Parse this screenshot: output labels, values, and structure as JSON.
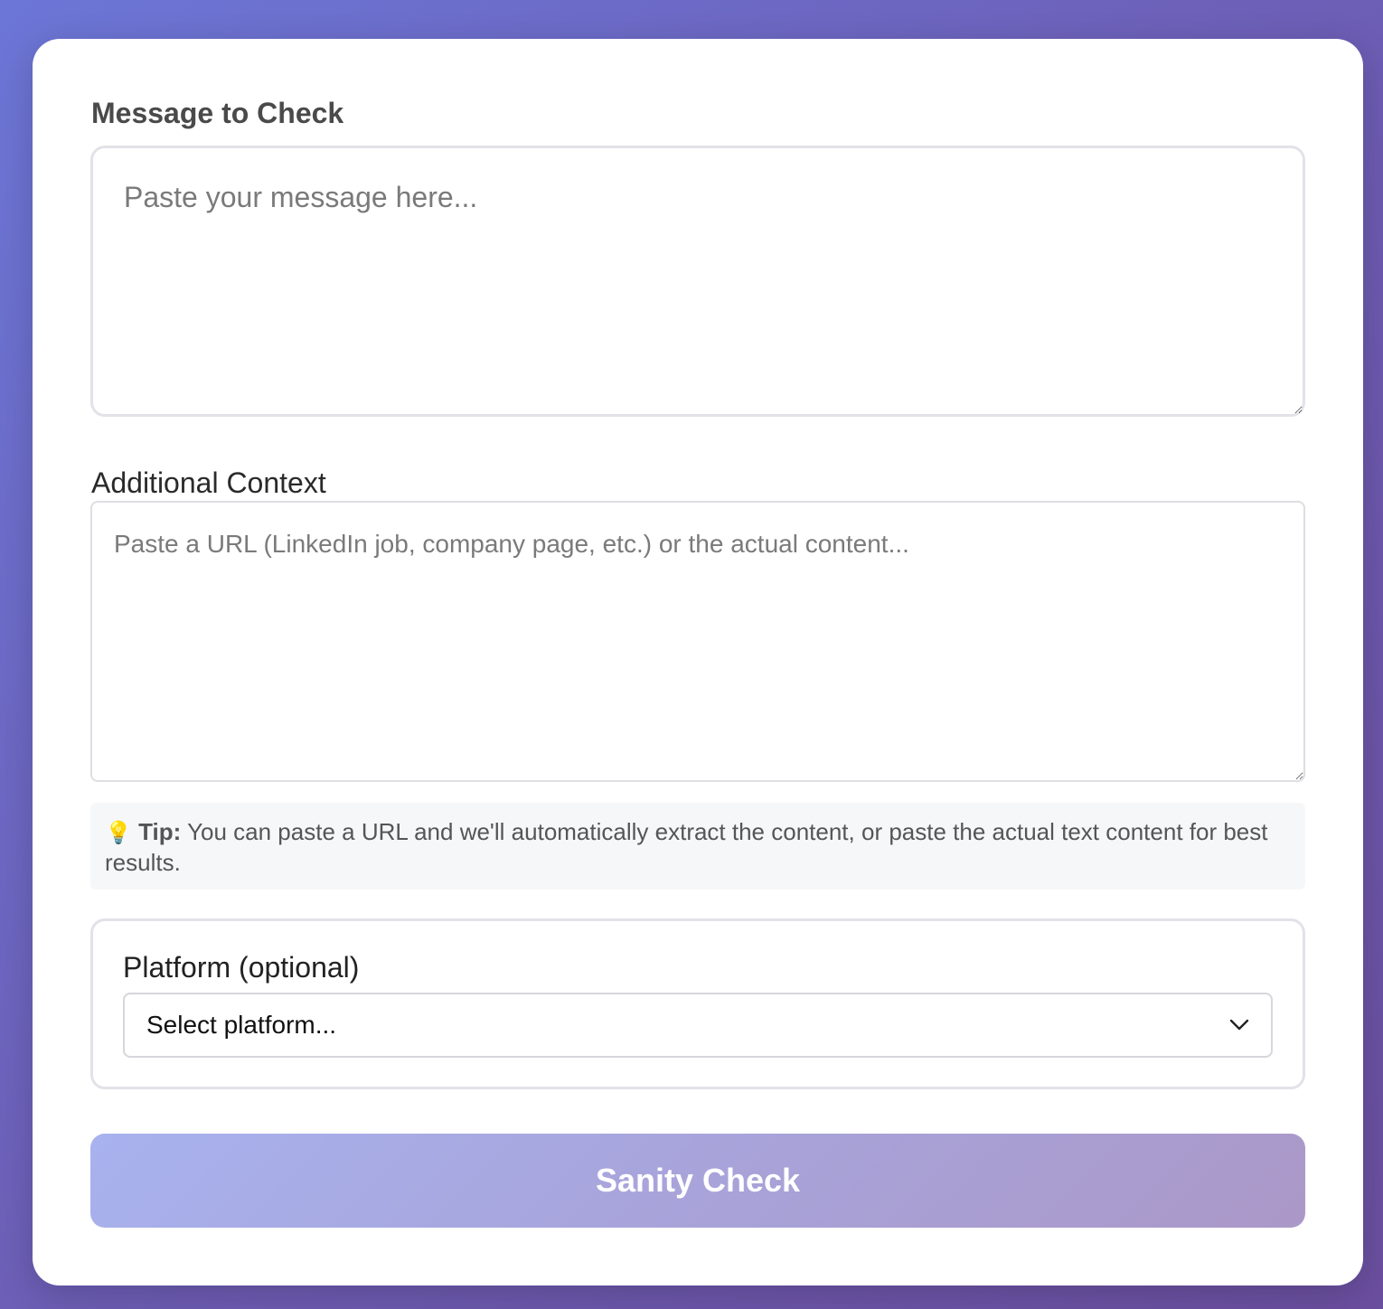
{
  "form": {
    "message": {
      "label": "Message to Check",
      "placeholder": "Paste your message here...",
      "value": ""
    },
    "context": {
      "label": "Additional Context",
      "placeholder": "Paste a URL (LinkedIn job, company page, etc.) or the actual content...",
      "value": ""
    },
    "tip": {
      "icon": "lightbulb-icon",
      "prefix": "Tip:",
      "text": " You can paste a URL and we'll automatically extract the content, or paste the actual text content for best results."
    },
    "platform": {
      "label": "Platform (optional)",
      "selected": "Select platform..."
    },
    "submit_label": "Sanity Check"
  },
  "colors": {
    "background_start": "#6c76d6",
    "background_end": "#6b4f9f",
    "button_start": "#a8b2ee",
    "button_end": "#ab98c8"
  }
}
